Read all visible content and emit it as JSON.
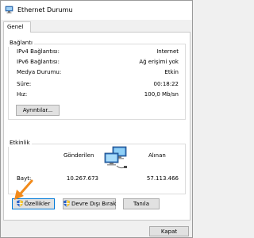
{
  "window": {
    "title": "Ethernet Durumu"
  },
  "tabs": [
    {
      "label": "Genel"
    }
  ],
  "connection": {
    "group_label": "Bağlantı",
    "rows": [
      {
        "label": "IPv4 Bağlantısı:",
        "value": "Internet"
      },
      {
        "label": "IPv6 Bağlantısı:",
        "value": "Ağ erişimi yok"
      },
      {
        "label": "Medya Durumu:",
        "value": "Etkin"
      },
      {
        "label": "Süre:",
        "value": "00:18:22"
      },
      {
        "label": "Hız:",
        "value": "100,0 Mb/sn"
      }
    ],
    "details_button": "Ayrıntılar..."
  },
  "activity": {
    "group_label": "Etkinlik",
    "sent_label": "Gönderilen",
    "received_label": "Alınan",
    "bytes_label": "Bayt:",
    "bytes_sent": "10.267.673",
    "bytes_received": "57.113.466"
  },
  "buttons": {
    "properties": "Özellikler",
    "disable": "Devre Dışı Bırak",
    "diagnose": "Tanıla",
    "close": "Kapat"
  },
  "colors": {
    "accent": "#0078d7",
    "annotation_arrow": "#f28a1a"
  }
}
